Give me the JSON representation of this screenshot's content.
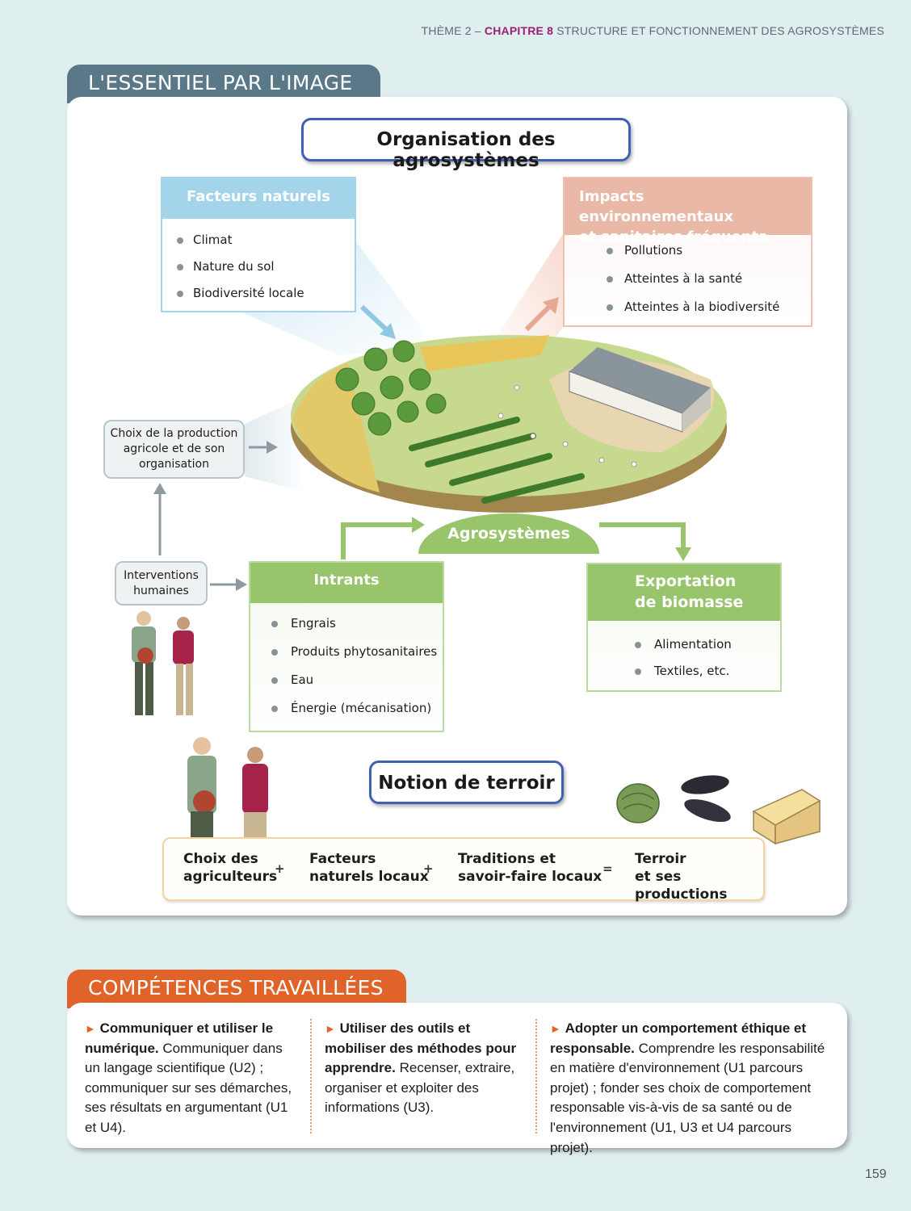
{
  "header": {
    "theme": "THÈME 2 –",
    "chapter": "CHAPITRE 8",
    "chapter_title": "STRUCTURE ET FONCTIONNEMENT DES AGROSYSTÈMES"
  },
  "essentiel": {
    "tab_title": "L'ESSENTIEL PAR L'IMAGE",
    "main_title": "Organisation des agrosystèmes",
    "facteurs": {
      "title": "Facteurs naturels",
      "items": [
        "Climat",
        "Nature du sol",
        "Biodiversité locale"
      ]
    },
    "impacts": {
      "title_line1": "Impacts environnementaux",
      "title_line2": "et sanitaires fréquents",
      "items": [
        "Pollutions",
        "Atteintes à la santé",
        "Atteintes à la biodiversité"
      ]
    },
    "choix_production": {
      "line1": "Choix de la production",
      "line2": "agricole et de son",
      "line3": "organisation"
    },
    "interventions": {
      "line1": "Interventions",
      "line2": "humaines"
    },
    "agrosystemes_label": "Agrosystèmes",
    "intrants": {
      "title": "Intrants",
      "items": [
        "Engrais",
        "Produits phytosanitaires",
        "Eau",
        "Énergie (mécanisation)"
      ]
    },
    "exportation": {
      "title_line1": "Exportation",
      "title_line2": "de biomasse",
      "items": [
        "Alimentation",
        "Textiles, etc."
      ]
    },
    "terroir": {
      "title": "Notion de terroir",
      "choix_l1": "Choix des",
      "choix_l2": "agriculteurs",
      "facteurs_l1": "Facteurs",
      "facteurs_l2": "naturels locaux",
      "traditions_l1": "Traditions et",
      "traditions_l2": "savoir-faire locaux",
      "result_l1": "Terroir",
      "result_l2": "et ses productions",
      "plus": "+",
      "equals": "="
    }
  },
  "competences": {
    "tab_title": "COMPÉTENCES TRAVAILLÉES",
    "columns": [
      {
        "bold": "Communiquer et utiliser le numérique.",
        "text": "Communiquer dans un langage scientifique (U2) ; communiquer sur ses démarches, ses résultats en argumentant (U1 et U4)."
      },
      {
        "bold": "Utiliser des outils et mobiliser des méthodes pour apprendre.",
        "text": "Recenser, extraire, organiser et exploiter des informations (U3)."
      },
      {
        "bold": "Adopter un comportement éthique et responsable.",
        "text": "Comprendre les responsabilité en matière d'environnement (U1 parcours projet) ; fonder ses choix de comportement responsable vis-à-vis de sa santé ou de l'environnement  (U1, U3 et U4 parcours projet)."
      }
    ]
  },
  "page_number": "159",
  "colors": {
    "theme_blue": "#3e61b4",
    "chapter_purple": "#9b1f74",
    "facteurs_blue": "#a3d4ea",
    "impacts_salmon": "#eab8a6",
    "intrants_green": "#98c46b",
    "competences_orange": "#e0642a",
    "essentiel_slate": "#5a7887"
  }
}
